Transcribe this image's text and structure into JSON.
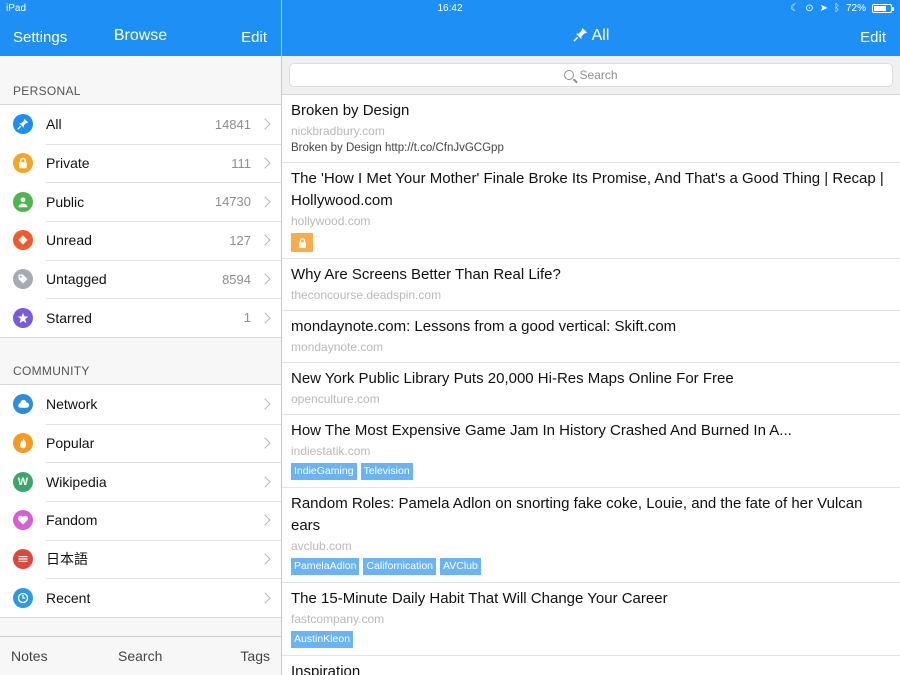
{
  "status": {
    "device": "iPad",
    "time": "16:42",
    "battery": "72%",
    "battery_level": 0.72
  },
  "sidebar_nav": {
    "left_button": "Settings",
    "title": "Browse",
    "right_button": "Edit"
  },
  "main_nav": {
    "title": "All",
    "right_button": "Edit"
  },
  "personal": {
    "header": "PERSONAL",
    "items": [
      {
        "label": "All",
        "count": "14841",
        "icon": "pin-icon",
        "color": "#1e8ef4"
      },
      {
        "label": "Private",
        "count": "111",
        "icon": "lock-icon",
        "color": "#f5a623"
      },
      {
        "label": "Public",
        "count": "14730",
        "icon": "person-icon",
        "color": "#4cb64c"
      },
      {
        "label": "Unread",
        "count": "127",
        "icon": "unread-diamond-icon",
        "color": "#ef5a2f"
      },
      {
        "label": "Untagged",
        "count": "8594",
        "icon": "tag-icon",
        "color": "#a7a9b3"
      },
      {
        "label": "Starred",
        "count": "1",
        "icon": "star-icon",
        "color": "#7a5ad8"
      }
    ]
  },
  "community": {
    "header": "COMMUNITY",
    "items": [
      {
        "label": "Network",
        "icon": "cloud-icon",
        "color": "#2b8ed6"
      },
      {
        "label": "Popular",
        "icon": "flame-icon",
        "color": "#f59a23"
      },
      {
        "label": "Wikipedia",
        "icon": "wikipedia-icon",
        "color": "#3aa66a"
      },
      {
        "label": "Fandom",
        "icon": "heart-icon",
        "color": "#d660d3"
      },
      {
        "label": "日本語",
        "icon": "japan-icon",
        "color": "#e0463a"
      },
      {
        "label": "Recent",
        "icon": "clock-icon",
        "color": "#2b9be0"
      }
    ]
  },
  "tabbar": {
    "notes": "Notes",
    "search": "Search",
    "tags": "Tags"
  },
  "search": {
    "placeholder": "Search"
  },
  "bookmarks": [
    {
      "title": "Broken by Design",
      "url": "nickbradbury.com",
      "desc": "Broken by Design http://t.co/CfnJvGCGpp",
      "tags": [],
      "private": false
    },
    {
      "title": "The 'How I Met Your Mother' Finale Broke Its Promise, And That's a Good Thing | Recap | Hollywood.com",
      "url": "hollywood.com",
      "desc": "",
      "tags": [],
      "private": true
    },
    {
      "title": "Why Are Screens Better Than Real Life?",
      "url": "theconcourse.deadspin.com",
      "desc": "",
      "tags": [],
      "private": false
    },
    {
      "title": "mondaynote.com: Lessons from a good vertical: Skift.com",
      "url": "mondaynote.com",
      "desc": "",
      "tags": [],
      "private": false
    },
    {
      "title": "New York Public Library Puts 20,000 Hi-Res Maps Online For Free",
      "url": "openculture.com",
      "desc": "",
      "tags": [],
      "private": false
    },
    {
      "title": "How The Most Expensive Game Jam In History Crashed And Burned In A...",
      "url": "indiestatik.com",
      "desc": "",
      "tags": [
        "IndieGaming",
        "Television"
      ],
      "private": false
    },
    {
      "title": "Random Roles: Pamela Adlon on snorting fake coke, Louie, and the fate of her Vulcan ears",
      "url": "avclub.com",
      "desc": "",
      "tags": [
        "PamelaAdlon",
        "Californication",
        "AVClub"
      ],
      "private": false
    },
    {
      "title": "The 15-Minute Daily Habit That Will Change Your Career",
      "url": "fastcompany.com",
      "desc": "",
      "tags": [
        "AustinKleon"
      ],
      "private": false
    },
    {
      "title": "Inspiration",
      "url": "",
      "desc": "",
      "tags": [],
      "private": false
    }
  ]
}
